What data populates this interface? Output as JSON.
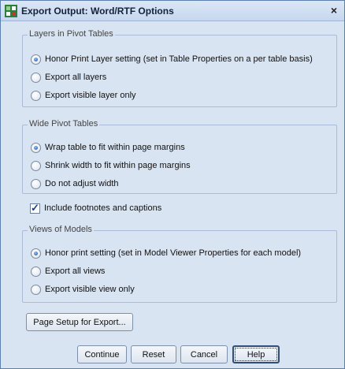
{
  "window": {
    "title": "Export Output: Word/RTF Options",
    "close_glyph": "×"
  },
  "layers_group": {
    "legend": "Layers in Pivot Tables",
    "options": [
      {
        "label": "Honor Print Layer setting (set in Table Properties on a per table basis)",
        "checked": true
      },
      {
        "label": "Export all layers",
        "checked": false
      },
      {
        "label": "Export visible layer only",
        "checked": false
      }
    ]
  },
  "wide_group": {
    "legend": "Wide Pivot Tables",
    "options": [
      {
        "label": "Wrap table to fit within page margins",
        "checked": true
      },
      {
        "label": "Shrink width to fit within page margins",
        "checked": false
      },
      {
        "label": "Do not adjust width",
        "checked": false
      }
    ]
  },
  "footnotes": {
    "label": "Include footnotes and captions",
    "checked": true
  },
  "models_group": {
    "legend": "Views of Models",
    "options": [
      {
        "label": "Honor print setting (set in Model Viewer Properties for each model)",
        "checked": true
      },
      {
        "label": "Export all views",
        "checked": false
      },
      {
        "label": "Export visible view only",
        "checked": false
      }
    ]
  },
  "buttons": {
    "page_setup": "Page Setup for Export...",
    "continue": "Continue",
    "reset": "Reset",
    "cancel": "Cancel",
    "help": "Help"
  },
  "icons": {
    "app": "spss-app-icon",
    "close": "close-icon"
  },
  "colors": {
    "dialog_bg": "#d8e4f2",
    "group_border": "#a9bbd6",
    "radio_selected": "#2a62b8"
  }
}
